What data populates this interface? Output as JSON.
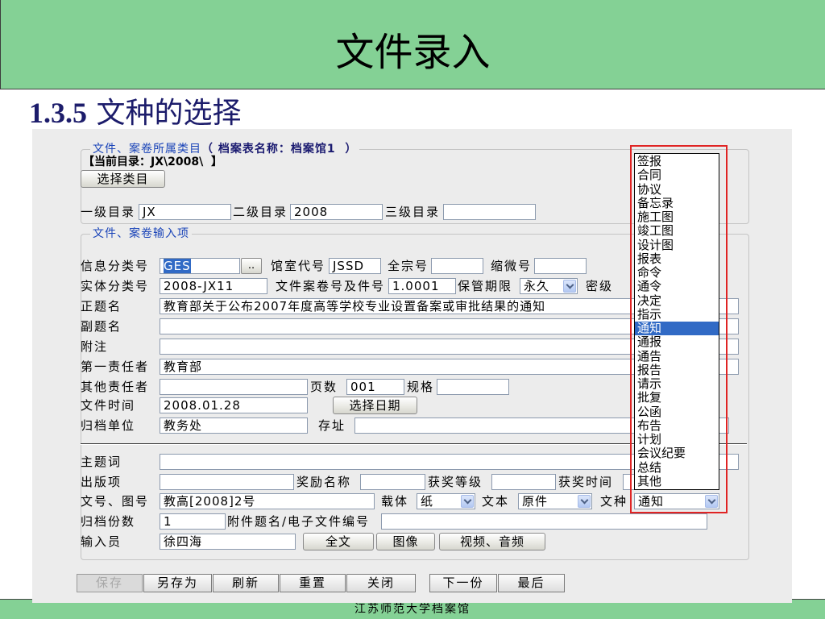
{
  "slide": {
    "title": "文件录入",
    "subtitle_number": "1.3.5",
    "subtitle_text": "文种的选择",
    "footer": "江苏师范大学档案馆"
  },
  "colors": {
    "header_bg": "#84d195",
    "subtitle": "#1c1c6b",
    "legend": "#1a44b8",
    "highlight_box": "#e02424",
    "selection": "#316ac5"
  },
  "category_group": {
    "legend": "文件、案卷所属类目",
    "legend_detail": "（ 档案表名称：档案馆1  ）",
    "current_dir": "【当前目录：JX\\2008\\  】",
    "select_button": "选择类目",
    "level1": {
      "label": "一级目录",
      "value": "JX"
    },
    "level2": {
      "label": "二级目录",
      "value": "2008"
    },
    "level3": {
      "label": "三级目录",
      "value": ""
    }
  },
  "input_group": {
    "legend": "文件、案卷输入项",
    "info_class": {
      "label": "信息分类号",
      "value": "GES",
      "browse": ".."
    },
    "room_code": {
      "label": "馆室代号",
      "value": "JSSD"
    },
    "fonds_no": {
      "label": "全宗号",
      "value": ""
    },
    "microfilm_no": {
      "label": "缩微号",
      "value": ""
    },
    "entity_class": {
      "label": "实体分类号",
      "value": "2008-JX11"
    },
    "file_no": {
      "label": "文件案卷号及件号",
      "value": "1.0001"
    },
    "retention": {
      "label": "保管期限",
      "value": "永久"
    },
    "secrecy": {
      "label": "密级"
    },
    "title": {
      "label": "正题名",
      "value": "教育部关于公布2007年度高等学校专业设置备案或审批结果的通知"
    },
    "subtitle": {
      "label": "副题名",
      "value": ""
    },
    "note": {
      "label": "附注",
      "value": ""
    },
    "first_author": {
      "label": "第一责任者",
      "value": "教育部"
    },
    "other_author": {
      "label": "其他责任者",
      "value": ""
    },
    "pages": {
      "label": "页数",
      "value": "001"
    },
    "spec": {
      "label": "规格",
      "value": ""
    },
    "file_date": {
      "label": "文件时间",
      "value": "2008.01.28",
      "button": "选择日期"
    },
    "archive_unit": {
      "label": "归档单位",
      "value": "教务处"
    },
    "location": {
      "label": "存址",
      "value": ""
    },
    "keywords": {
      "label": "主题词",
      "value": ""
    },
    "publication": {
      "label": "出版项",
      "value": ""
    },
    "award_name": {
      "label": "奖励名称",
      "value": ""
    },
    "award_level": {
      "label": "获奖等级",
      "value": ""
    },
    "award_time": {
      "label": "获奖时间",
      "value": ""
    },
    "doc_no": {
      "label": "文号、图号",
      "value": "教高[2008]2号"
    },
    "carrier": {
      "label": "载体",
      "value": "纸"
    },
    "text_type": {
      "label": "文本",
      "value": "原件"
    },
    "doc_type": {
      "label": "文种",
      "value": "通知"
    },
    "copies": {
      "label": "归档份数",
      "value": "1"
    },
    "attachment": {
      "label": "附件题名/电子文件编号",
      "value": ""
    },
    "operator": {
      "label": "输入员",
      "value": "徐四海"
    },
    "media_buttons": [
      "全文",
      "图像",
      "视频、音频"
    ]
  },
  "toolbar": {
    "buttons": [
      {
        "label": "保存",
        "disabled": true
      },
      {
        "label": "另存为",
        "disabled": false
      },
      {
        "label": "刷新",
        "disabled": false
      },
      {
        "label": "重置",
        "disabled": false
      },
      {
        "label": "关闭",
        "disabled": false
      },
      {
        "label": "下一份",
        "disabled": false
      },
      {
        "label": "最后",
        "disabled": false
      }
    ]
  },
  "doc_type_list": {
    "items": [
      "签报",
      "合同",
      "协议",
      "备忘录",
      "施工图",
      "竣工图",
      "设计图",
      "报表",
      "命令",
      "通令",
      "决定",
      "指示",
      "通知",
      "通报",
      "通告",
      "报告",
      "请示",
      "批复",
      "公函",
      "布告",
      "计划",
      "会议纪要",
      "总结",
      "其他"
    ],
    "selected_index": 12
  }
}
